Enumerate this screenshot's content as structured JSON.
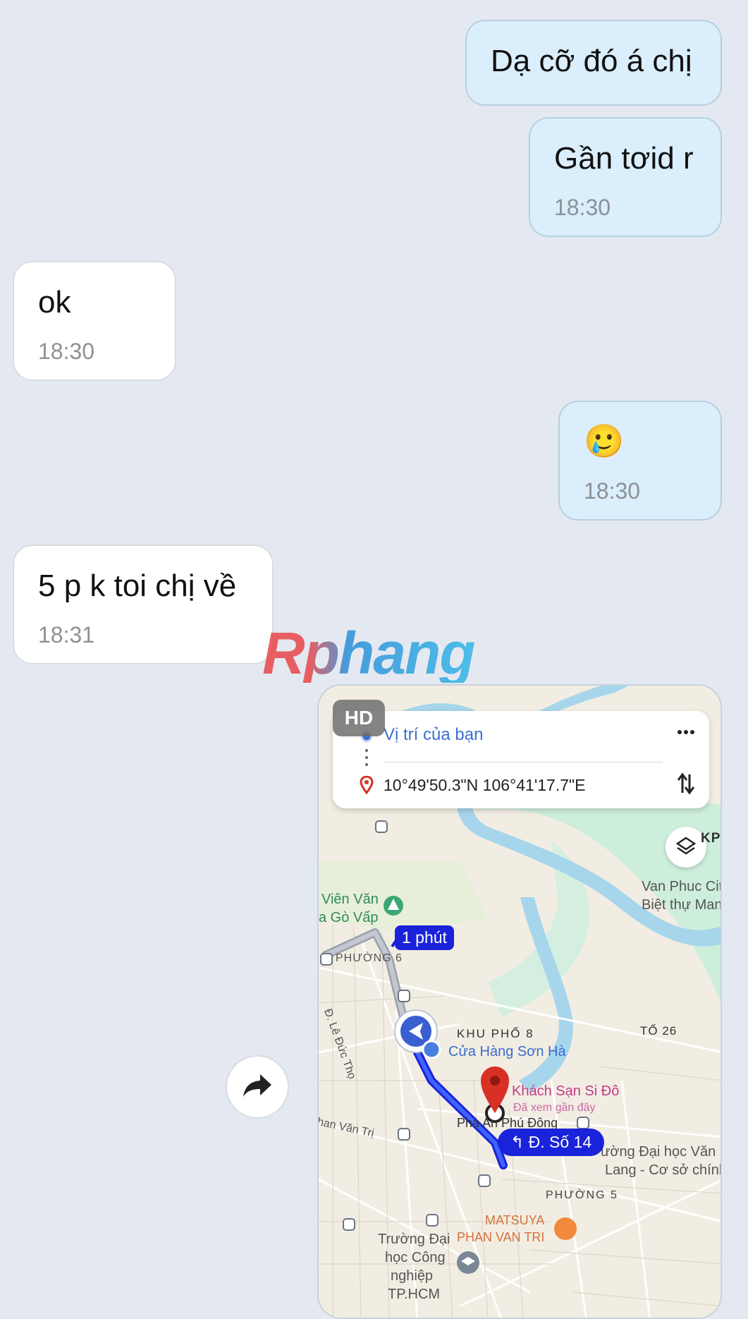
{
  "messages": [
    {
      "direction": "out",
      "text": "Dạ cỡ đó á chị",
      "time": ""
    },
    {
      "direction": "out",
      "text": "Gần tơid r",
      "time": "18:30"
    },
    {
      "direction": "in",
      "text": "ok",
      "time": "18:30"
    },
    {
      "direction": "out",
      "text": "🥲",
      "time": "18:30"
    },
    {
      "direction": "in",
      "text": "5 p k toi chị về",
      "time": "18:31"
    }
  ],
  "watermark": "Rphang",
  "map_message": {
    "hd_badge": "HD",
    "origin": "Vị trí của bạn",
    "destination": "10°49'50.3\"N 106°41'17.7\"E",
    "route_time": "1 phút",
    "turn_street": "Đ. Số 14",
    "labels": {
      "kp": "KP",
      "van_phuc_1": "Van Phuc Cit",
      "van_phuc_2": "Biệt thự Mans",
      "vien_van": "Viên Văn",
      "go_vap": "a Gò Vấp",
      "phuong6": "PHƯỜNG 6",
      "le_duc_tho": "Đ. Lê Đức Thọ",
      "khu_pho_8": "KHU PHỐ 8",
      "to_26": "TỔ 26",
      "cua_hang": "Cửa Hàng Sơn Hà",
      "khach_san": "Khách Sạn Si Đô",
      "da_xem": "Đã xem gần đây",
      "pha_an": "Phà An Phú Đông",
      "han_van_tri": "han Văn Trị",
      "dai_hoc_1": "ường Đại học Văn",
      "dai_hoc_2": "Lang - Cơ sở chính",
      "phuong5": "PHƯỜNG 5",
      "matsuya_1": "MATSUYA",
      "matsuya_2": "PHAN VAN TRI",
      "truong_1": "Trường Đại",
      "truong_2": "học Công",
      "truong_3": "nghiệp",
      "truong_4": "TP.HCM"
    }
  },
  "colors": {
    "background": "#e4e9f1",
    "outgoing_bubble": "#daeefc",
    "incoming_bubble": "#ffffff",
    "route": "#1a23d9",
    "pin": "#d93025"
  }
}
